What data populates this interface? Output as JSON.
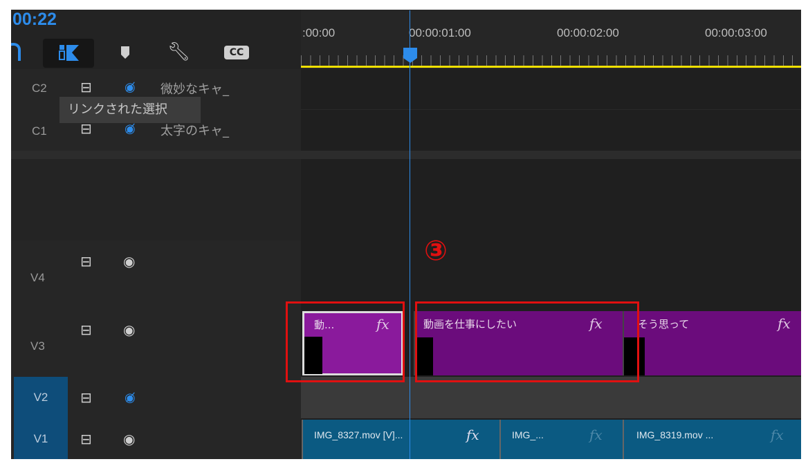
{
  "timecode": "00:22",
  "toolbar": {
    "icons": [
      "snap-icon",
      "linked-selection-icon",
      "marker-icon",
      "wrench-icon",
      "captions-icon"
    ],
    "cc_label": "CC"
  },
  "tooltip": "リンクされた選択",
  "ruler": {
    "labels": [
      ":00:00",
      "00:00:01:00",
      "00:00:02:00",
      "00:00:03:00"
    ]
  },
  "tracks": {
    "c2": {
      "name": "C2",
      "caption": "微妙なキャ_"
    },
    "c1": {
      "name": "C1",
      "caption": "太字のキャ_"
    },
    "v4": {
      "name": "V4"
    },
    "v3": {
      "name": "V3"
    },
    "v2": {
      "name": "V2"
    },
    "v1": {
      "name": "V1"
    }
  },
  "v3_clips": [
    {
      "title": "動...",
      "fx": "fx"
    },
    {
      "title": "動画を仕事にしたい",
      "fx": "fx"
    },
    {
      "title": "そう思って",
      "fx": "fx"
    }
  ],
  "v1_clips": [
    {
      "title": "IMG_8327.mov [V]...",
      "fx": "fx"
    },
    {
      "title": "IMG_...",
      "fx": "fx"
    },
    {
      "title": "IMG_8319.mov ...",
      "fx": "fx"
    }
  ],
  "annotation": "③",
  "colors": {
    "accent": "#2d8ceb",
    "caption_clip": "#6b0c7c",
    "video_clip": "#0b5a82",
    "highlight": "#e01010",
    "work_area": "#f0e000"
  }
}
